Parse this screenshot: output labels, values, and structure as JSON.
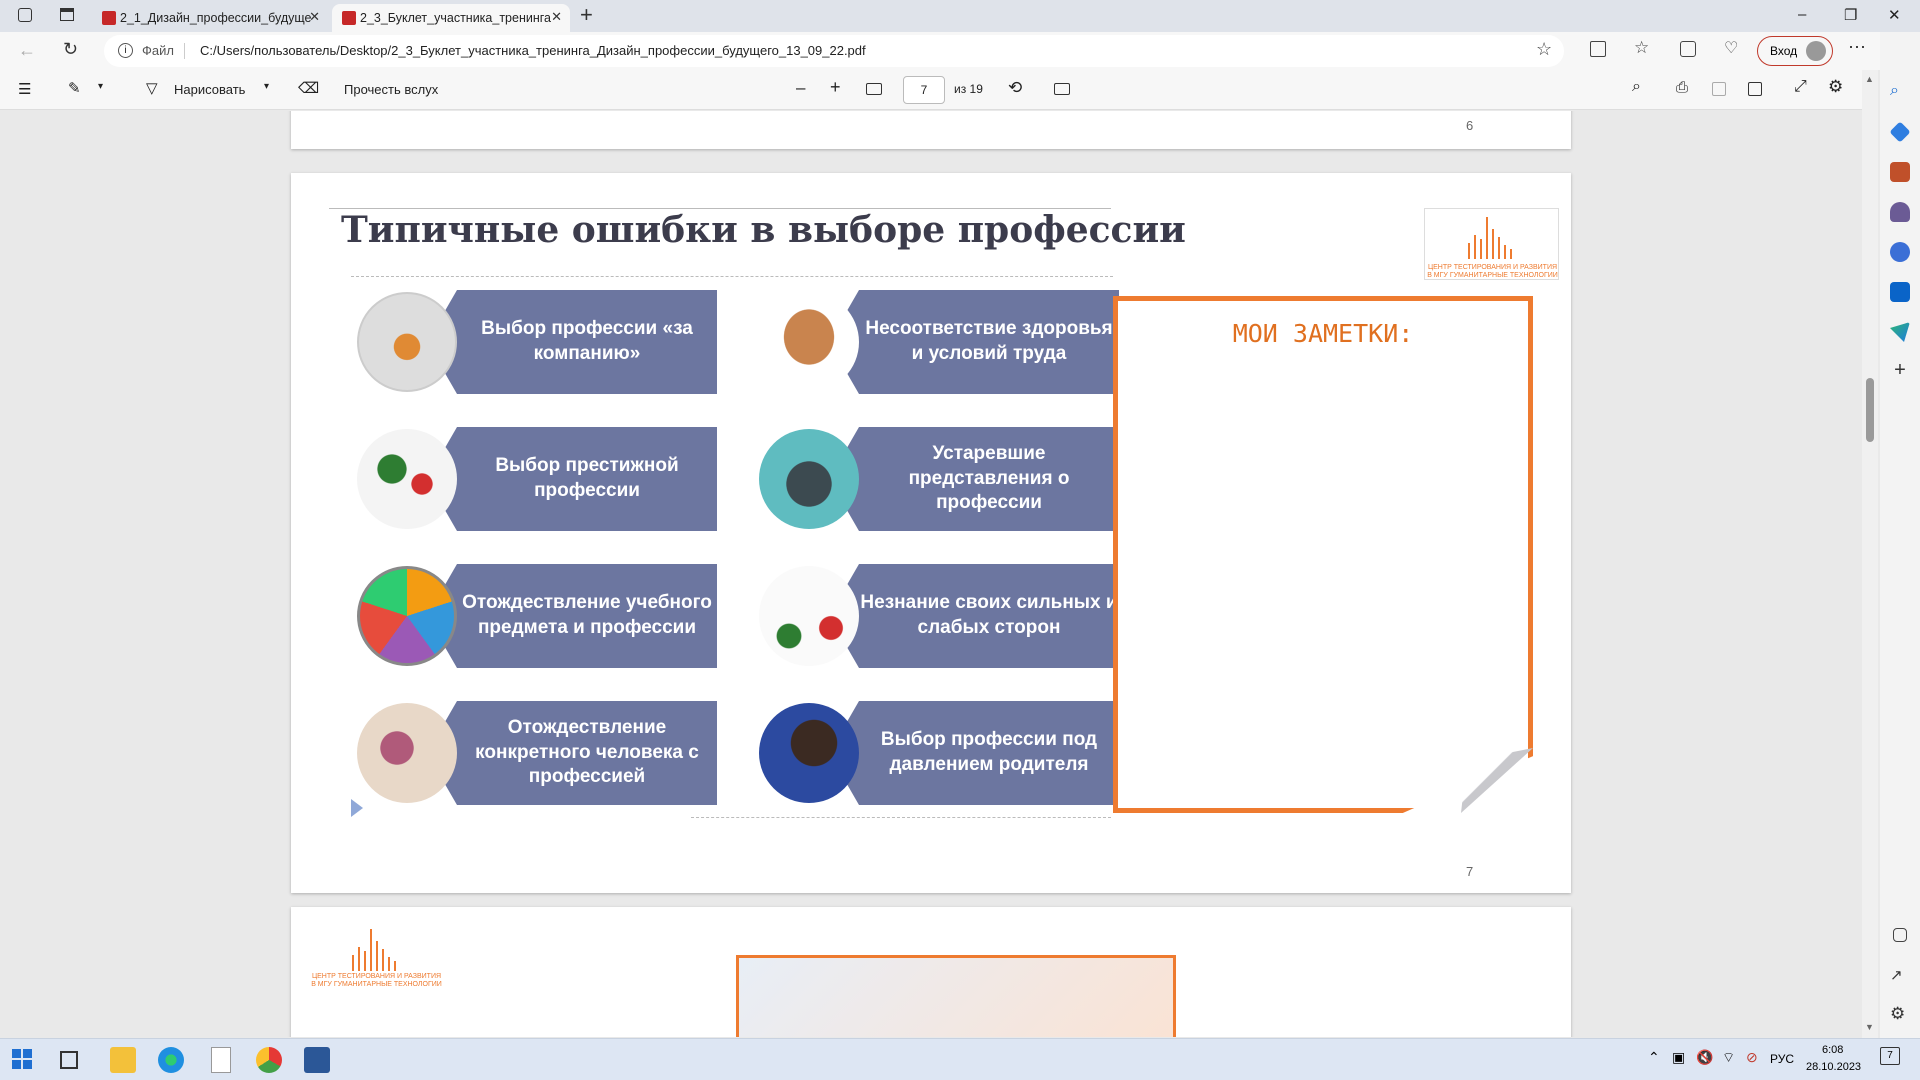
{
  "browser": {
    "tabs": [
      {
        "label": "2_1_Дизайн_профессии_будуще",
        "active": false
      },
      {
        "label": "2_3_Буклет_участника_тренинга",
        "active": true
      }
    ],
    "new_tab": "+",
    "address": {
      "scheme_label": "Файл",
      "url": "C:/Users/пользователь/Desktop/2_3_Буклет_участника_тренинга_Дизайн_профессии_будущего_13_09_22.pdf"
    },
    "signin_label": "Вход"
  },
  "pdf_toolbar": {
    "draw_label": "Нарисовать",
    "read_aloud_label": "Прочесть вслух",
    "current_page": "7",
    "page_total": "из 19"
  },
  "pages": {
    "prev_page_number": "6",
    "current_page_number": "7",
    "title": "Типичные ошибки в выборе профессии",
    "logo_text": "ЦЕНТР ТЕСТИРОВАНИЯ И РАЗВИТИЯ В МГУ ГУМАНИТАРНЫЕ ТЕХНОЛОГИИ",
    "cards_left": [
      {
        "text": "Выбор профессии «за компанию»",
        "icon": "people-group-icon"
      },
      {
        "text": "Выбор престижной профессии",
        "icon": "professions-icon"
      },
      {
        "text": "Отождествление учебного предмета и профессии",
        "icon": "pie-subjects-icon"
      },
      {
        "text": "Отождествление конкретного человека с профессией",
        "icon": "doctor-child-icon"
      }
    ],
    "cards_right": [
      {
        "text": "Несоответствие здоровья и условий труда",
        "icon": "muscle-arm-icon"
      },
      {
        "text": "Устаревшие представления о профессии",
        "icon": "old-phone-icon"
      },
      {
        "text": "Незнание своих сильных и слабых сторон",
        "icon": "scales-icon"
      },
      {
        "text": "Выбор профессии под давлением родителя",
        "icon": "parent-child-icon"
      }
    ],
    "notes_title": "МОИ ЗАМЕТКИ:",
    "next_page_logo_text": "ЦЕНТР ТЕСТИРОВАНИЯ И РАЗВИТИЯ В МГУ ГУМАНИТАРНЫЕ ТЕХНОЛОГИИ"
  },
  "taskbar": {
    "lang": "РУС",
    "time": "6:08",
    "date": "28.10.2023",
    "notification_count": "7"
  },
  "colors": {
    "card_fill": "#6c76a0",
    "accent_orange": "#ee7b30",
    "title": "#3c3c4c"
  }
}
